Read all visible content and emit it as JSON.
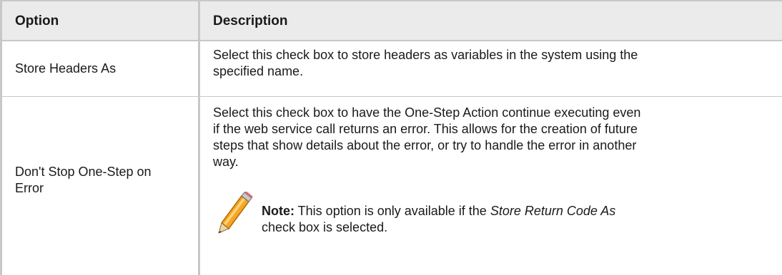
{
  "table": {
    "headers": {
      "option": "Option",
      "description": "Description"
    },
    "rows": [
      {
        "option": "Store Headers As",
        "description_lines": [
          "Select this check box to store headers as variables in the system using the",
          "specified name."
        ]
      },
      {
        "option_lines": [
          "Don't Stop One-Step on",
          "Error"
        ],
        "description_lines": [
          "Select this check box to have the One-Step Action continue executing even",
          "if the web service call returns an error. This allows for the creation of future",
          "steps that show details about the error, or try to handle the error in another",
          "way."
        ],
        "note": {
          "label": "Note:",
          "text_before": " This option is only available if the ",
          "emphasis": "Store Return Code As",
          "text_after": "check box is selected.",
          "icon": "pencil-icon"
        }
      }
    ]
  }
}
